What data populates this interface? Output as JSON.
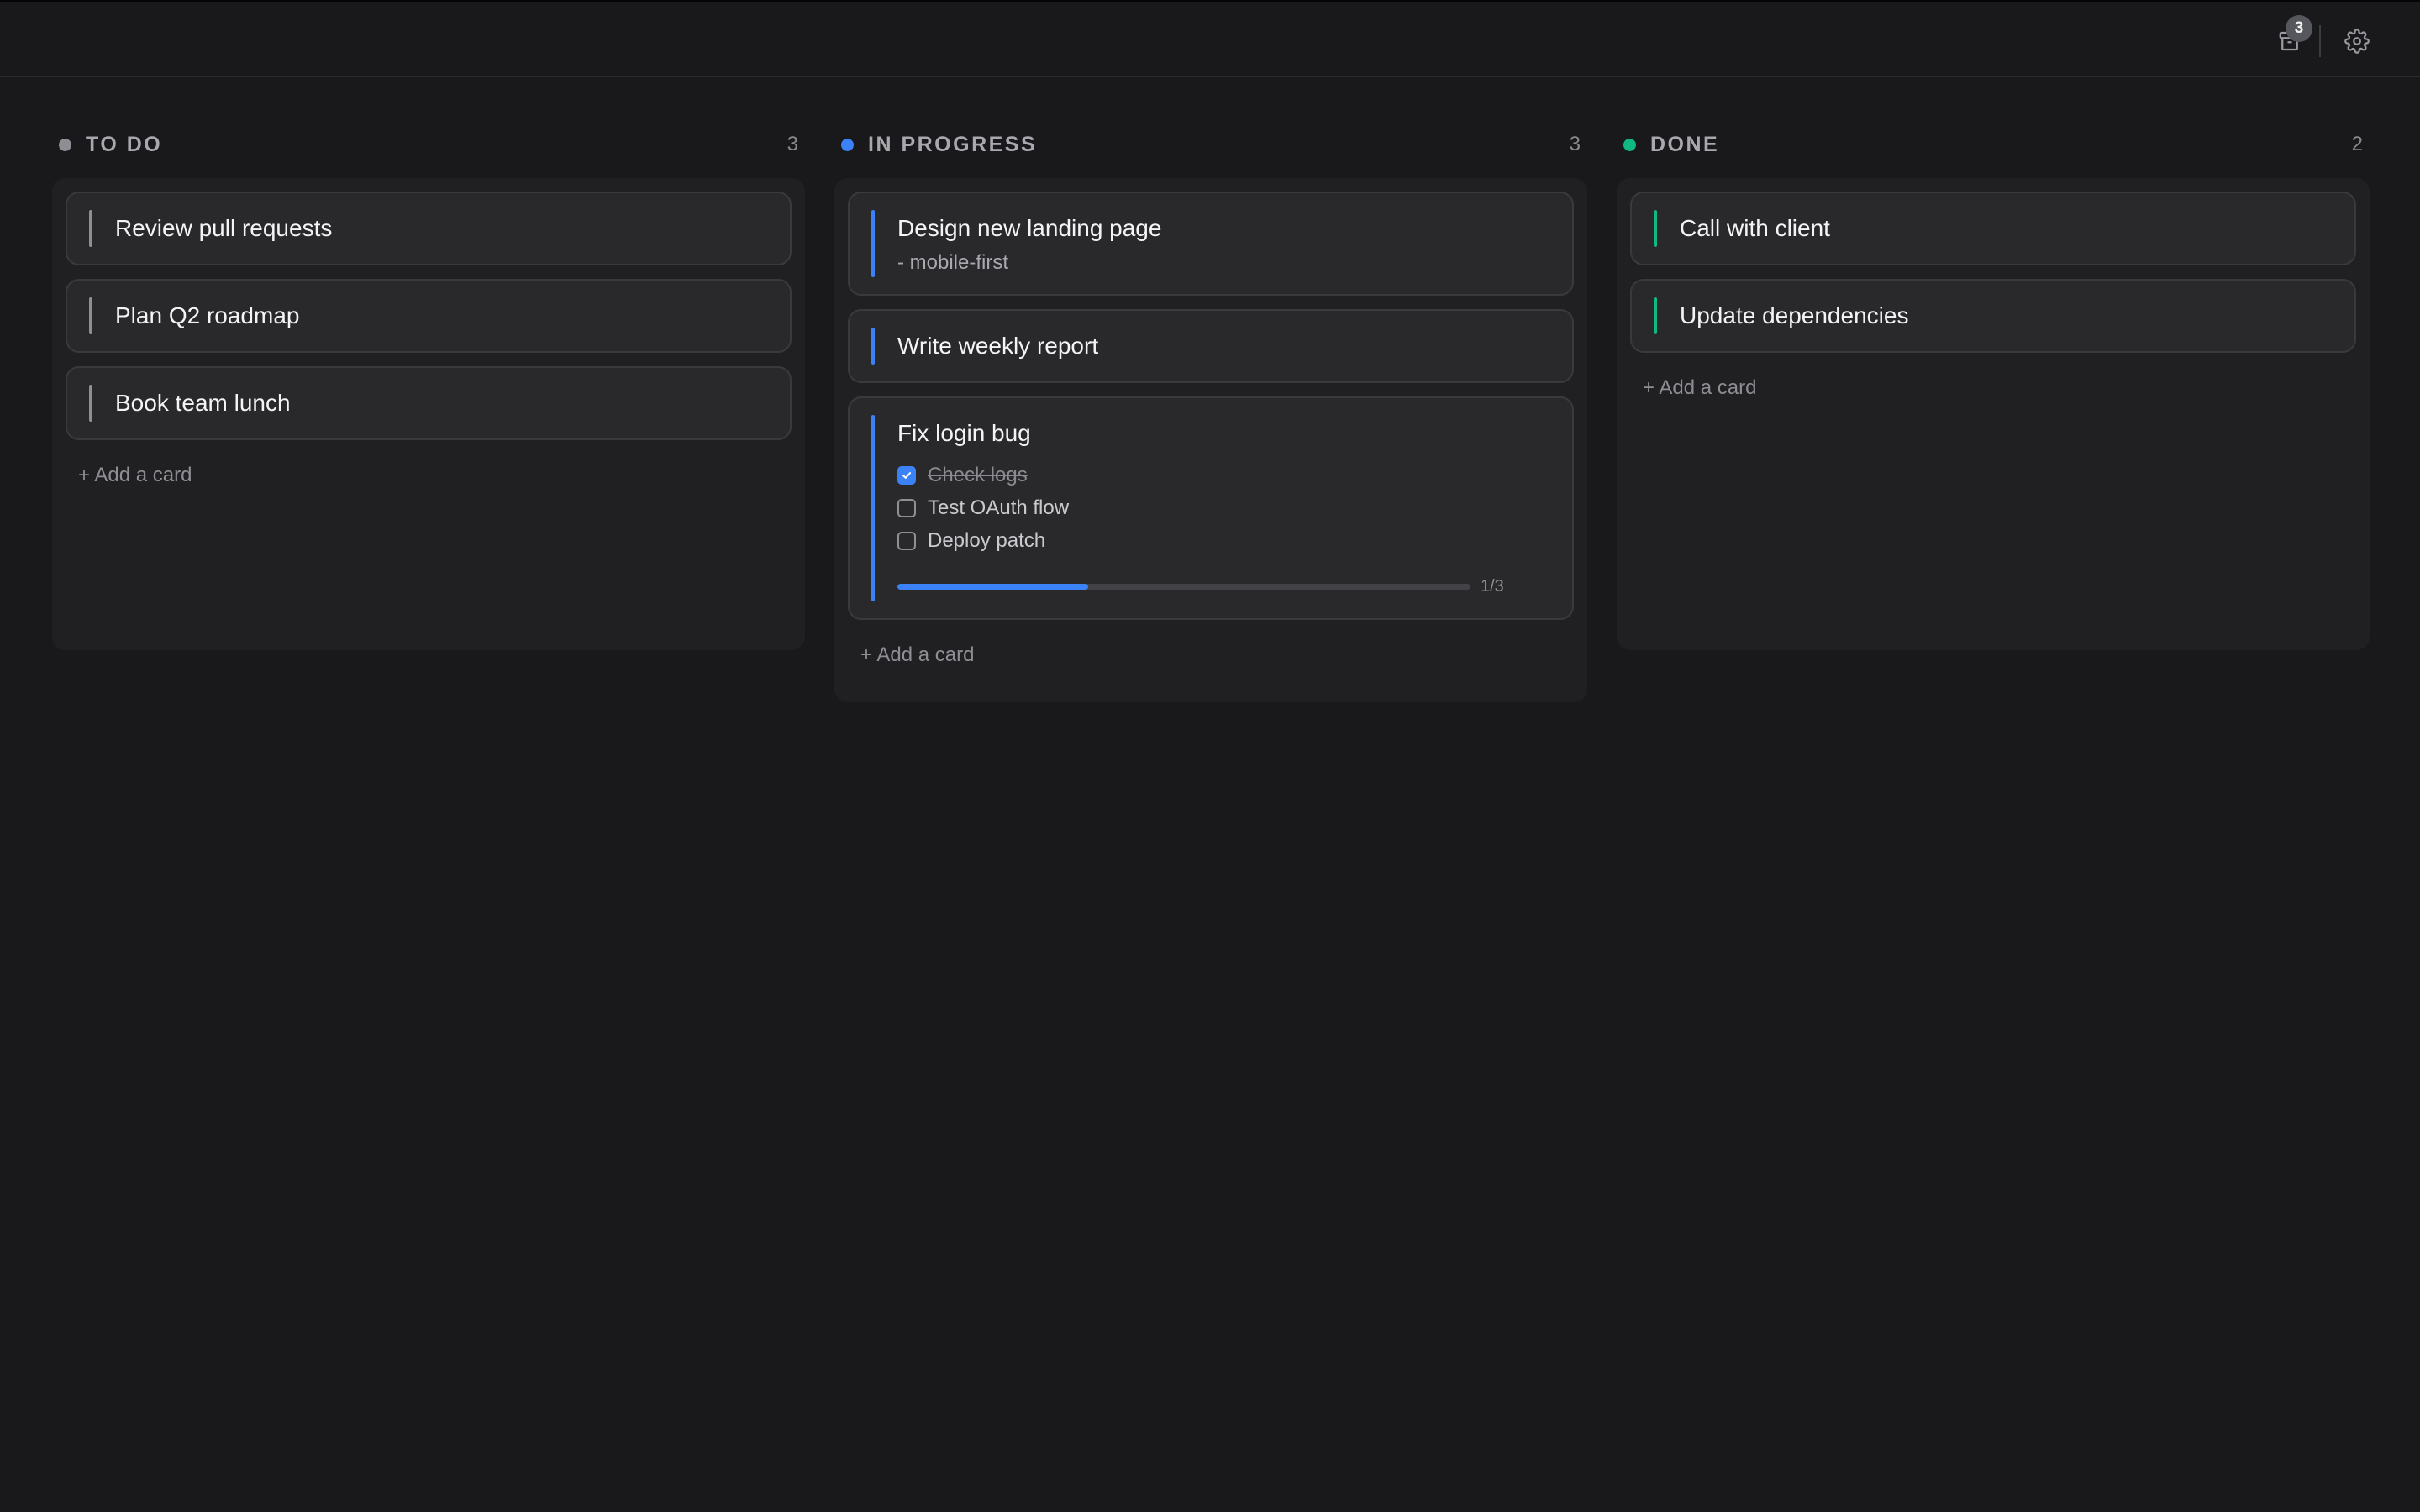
{
  "colors": {
    "todo_accent": "#8e8e94",
    "inprogress_accent": "#3b82f6",
    "done_accent": "#10b981",
    "progress_fill": "#3b82f6"
  },
  "topbar": {
    "archive_icon": "archive-box-icon",
    "archive_badge": "3",
    "settings_icon": "gear-icon"
  },
  "columns": [
    {
      "title": "TO DO",
      "count": "3",
      "cards": [
        {
          "title": "Review pull requests"
        },
        {
          "title": "Plan Q2 roadmap"
        },
        {
          "title": "Book team lunch"
        }
      ],
      "add_label": "+ Add a card"
    },
    {
      "title": "IN PROGRESS",
      "count": "3",
      "cards": [
        {
          "title": "Design new landing page",
          "subtitle": "- mobile-first"
        },
        {
          "title": "Write weekly report"
        },
        {
          "title": "Fix login bug",
          "checklist": [
            {
              "text": "Check logs",
              "checked": true
            },
            {
              "text": "Test OAuth flow",
              "checked": false
            },
            {
              "text": "Deploy patch",
              "checked": false
            }
          ],
          "progress": 0.3333,
          "progress_label": "1/3"
        }
      ],
      "add_label": "+ Add a card"
    },
    {
      "title": "DONE",
      "count": "2",
      "cards": [
        {
          "title": "Call with client"
        },
        {
          "title": "Update dependencies"
        }
      ],
      "add_label": "+ Add a card"
    }
  ]
}
